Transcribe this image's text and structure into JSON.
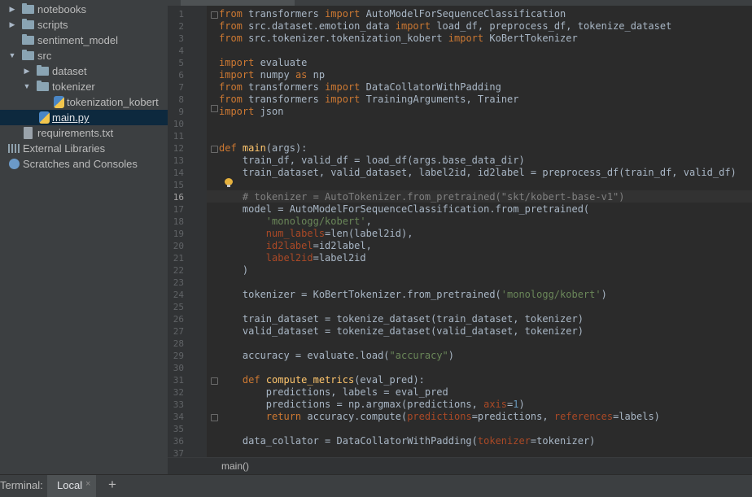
{
  "project": {
    "items": [
      {
        "label": "notebooks",
        "kind": "folder",
        "arrow": "▶"
      },
      {
        "label": "scripts",
        "kind": "folder",
        "arrow": "▶"
      },
      {
        "label": "sentiment_model",
        "kind": "folder",
        "arrow": ""
      },
      {
        "label": "src",
        "kind": "folder",
        "arrow": "▼"
      },
      {
        "label": "dataset",
        "kind": "folder",
        "arrow": "▶"
      },
      {
        "label": "tokenizer",
        "kind": "folder",
        "arrow": "▼"
      },
      {
        "label": "tokenization_kobert",
        "kind": "pyfile",
        "arrow": ""
      },
      {
        "label": "main.py",
        "kind": "pyfile",
        "arrow": ""
      },
      {
        "label": "requirements.txt",
        "kind": "txtfile",
        "arrow": ""
      },
      {
        "label": "External Libraries",
        "kind": "lib",
        "arrow": ""
      },
      {
        "label": "Scratches and Consoles",
        "kind": "scratch",
        "arrow": ""
      }
    ]
  },
  "editor": {
    "current_line": "16",
    "line_numbers": [
      "1",
      "2",
      "3",
      "4",
      "5",
      "6",
      "7",
      "8",
      "9",
      "10",
      "11",
      "12",
      "13",
      "14",
      "15",
      "16",
      "17",
      "18",
      "19",
      "20",
      "21",
      "22",
      "23",
      "24",
      "25",
      "26",
      "27",
      "28",
      "29",
      "30",
      "31",
      "32",
      "33",
      "34",
      "35",
      "36",
      "37"
    ],
    "breadcrumb": "main()"
  },
  "terminal": {
    "title": "Terminal:",
    "tab_label": "Local",
    "close_glyph": "×",
    "add_glyph": "+"
  },
  "colors": {
    "keyword": "#cc7832",
    "function": "#ffc66d",
    "string": "#6a8759",
    "comment": "#808080",
    "param": "#aa4926",
    "number": "#6897bb",
    "text": "#a9b7c6"
  }
}
